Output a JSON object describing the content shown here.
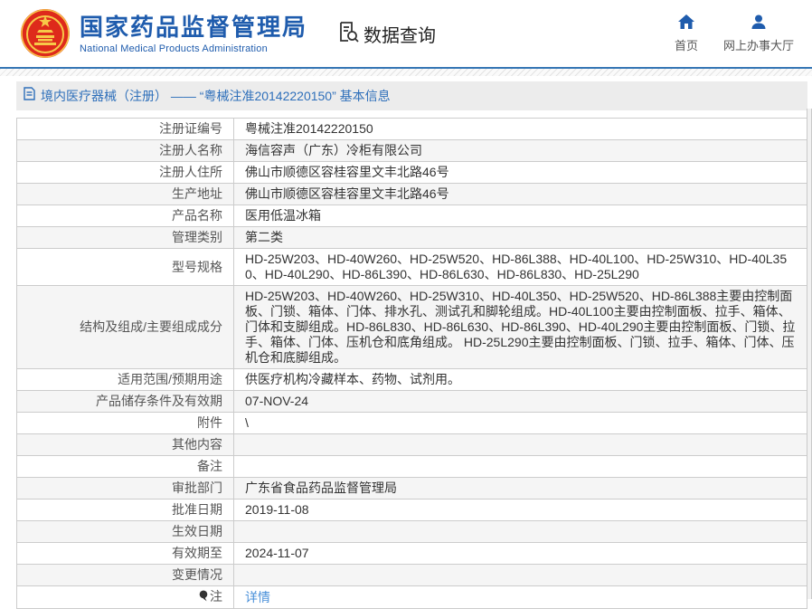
{
  "header": {
    "agency_name_cn": "国家药品监督管理局",
    "agency_name_en": "National Medical Products Administration",
    "nav_data_query": "数据查询",
    "nav_home": "首页",
    "nav_service_hall": "网上办事大厅"
  },
  "breadcrumb": {
    "text": "境内医疗器械（注册） —— “粤械注准20142220150” 基本信息"
  },
  "table": {
    "rows": [
      {
        "label": "注册证编号",
        "value": "粤械注准20142220150"
      },
      {
        "label": "注册人名称",
        "value": "海信容声（广东）冷柜有限公司"
      },
      {
        "label": "注册人住所",
        "value": "佛山市顺德区容桂容里文丰北路46号"
      },
      {
        "label": "生产地址",
        "value": "佛山市顺德区容桂容里文丰北路46号"
      },
      {
        "label": "产品名称",
        "value": "医用低温冰箱"
      },
      {
        "label": "管理类别",
        "value": "第二类"
      },
      {
        "label": "型号规格",
        "value": "HD-25W203、HD-40W260、HD-25W520、HD-86L388、HD-40L100、HD-25W310、HD-40L350、HD-40L290、HD-86L390、HD-86L630、HD-86L830、HD-25L290"
      },
      {
        "label": "结构及组成/主要组成成分",
        "value": "HD-25W203、HD-40W260、HD-25W310、HD-40L350、HD-25W520、HD-86L388主要由控制面板、门锁、箱体、门体、排水孔、测试孔和脚轮组成。HD-40L100主要由控制面板、拉手、箱体、门体和支脚组成。HD-86L830、HD-86L630、HD-86L390、HD-40L290主要由控制面板、门锁、拉手、箱体、门体、压机仓和底角组成。 HD-25L290主要由控制面板、门锁、拉手、箱体、门体、压机仓和底脚组成。"
      },
      {
        "label": "适用范围/预期用途",
        "value": "供医疗机构冷藏样本、药物、试剂用。"
      },
      {
        "label": "产品储存条件及有效期",
        "value": "07-NOV-24"
      },
      {
        "label": "附件",
        "value": "\\"
      },
      {
        "label": "其他内容",
        "value": ""
      },
      {
        "label": "备注",
        "value": ""
      },
      {
        "label": "审批部门",
        "value": "广东省食品药品监督管理局"
      },
      {
        "label": "批准日期",
        "value": "2019-11-08"
      },
      {
        "label": "生效日期",
        "value": ""
      },
      {
        "label": "有效期至",
        "value": "2024-11-07"
      },
      {
        "label": "变更情况",
        "value": ""
      },
      {
        "label": "注",
        "value": "详情",
        "is_link": true,
        "label_icon": "note-balloon-icon"
      }
    ]
  },
  "colors": {
    "brand_blue": "#1f5cad",
    "divider_blue": "#3576b4",
    "breadcrumb_text": "#2e6fba",
    "breadcrumb_bg": "#ececec",
    "table_border": "#cccccc",
    "row_stripe": "#f5f5f5",
    "link_blue": "#4a90d9",
    "emblem_red": "#de2a1b",
    "emblem_gold": "#f7c948"
  }
}
